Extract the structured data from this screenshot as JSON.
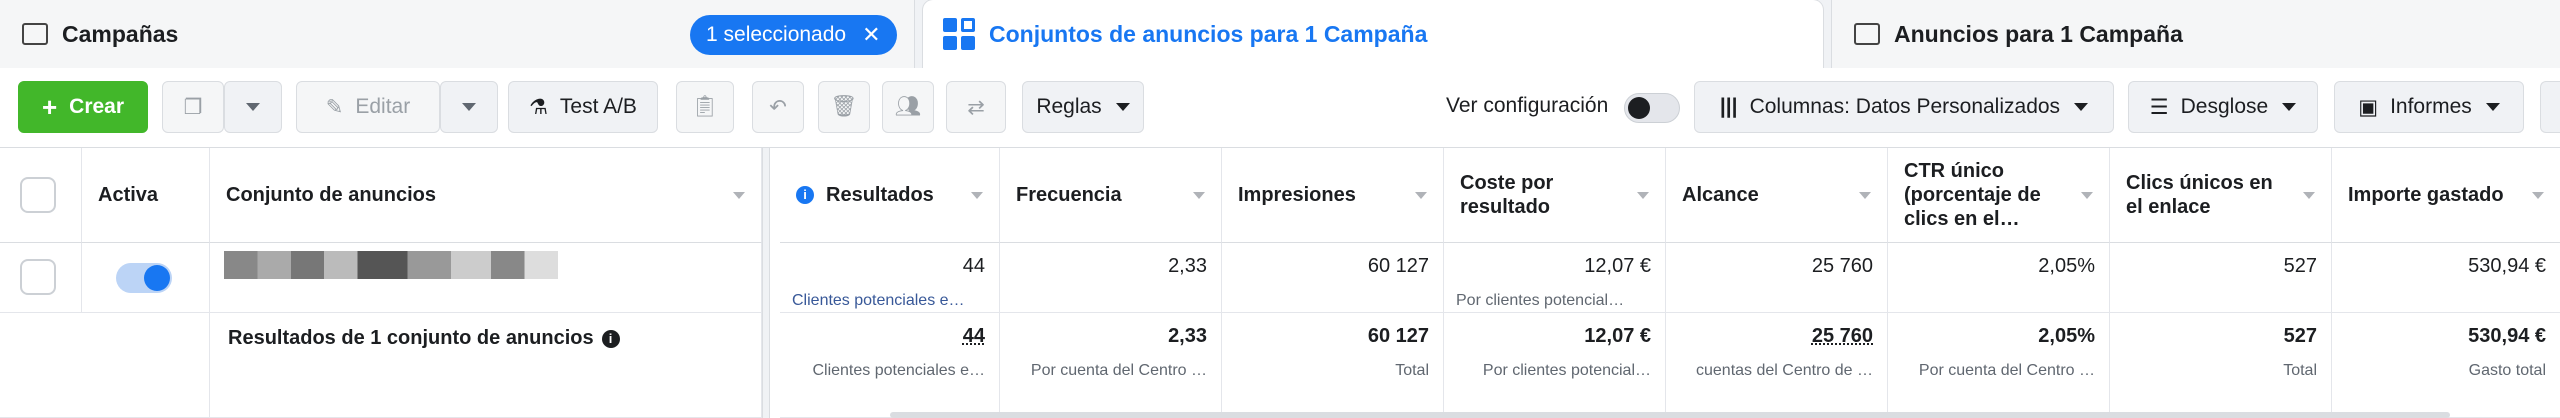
{
  "tabs": {
    "campaigns": "Campañas",
    "selected_pill": "1 seleccionado",
    "adsets": "Conjuntos de anuncios para 1 Campaña",
    "ads": "Anuncios para 1 Campaña"
  },
  "toolbar": {
    "create": "Crear",
    "edit": "Editar",
    "ab_test": "Test A/B",
    "rules": "Reglas",
    "view_config": "Ver configuración",
    "columns": "Columnas: Datos Personalizados",
    "breakdown": "Desglose",
    "reports": "Informes"
  },
  "colors": {
    "accent": "#1877f2",
    "create": "#42b72a"
  },
  "table": {
    "headers": {
      "active": "Activa",
      "adset": "Conjunto de anuncios",
      "results": "Resultados",
      "frequency": "Frecuencia",
      "impressions": "Impresiones",
      "cost_per_result": "Coste por resultado",
      "reach": "Alcance",
      "ctr": "CTR único (porcentaje de clics en el…",
      "unique_clicks": "Clics únicos en el enlace",
      "amount_spent": "Importe gastado"
    },
    "row": {
      "results": "44",
      "results_sub": "Clientes potenciales e…",
      "frequency": "2,33",
      "impressions": "60 127",
      "cost_per_result": "12,07 €",
      "cost_sub": "Por clientes potencial…",
      "reach": "25 760",
      "ctr": "2,05%",
      "unique_clicks": "527",
      "amount_spent": "530,94 €"
    },
    "totals": {
      "label": "Resultados de 1 conjunto de anuncios",
      "results": "44",
      "results_sub": "Clientes potenciales e…",
      "frequency": "2,33",
      "frequency_sub": "Por cuenta del Centro …",
      "impressions": "60 127",
      "impressions_sub": "Total",
      "cost_per_result": "12,07 €",
      "cost_sub": "Por clientes potencial…",
      "reach": "25 760",
      "reach_sub": "cuentas del Centro de …",
      "ctr": "2,05%",
      "ctr_sub": "Por cuenta del Centro …",
      "unique_clicks": "527",
      "unique_clicks_sub": "Total",
      "amount_spent": "530,94 €",
      "amount_spent_sub": "Gasto total"
    }
  }
}
